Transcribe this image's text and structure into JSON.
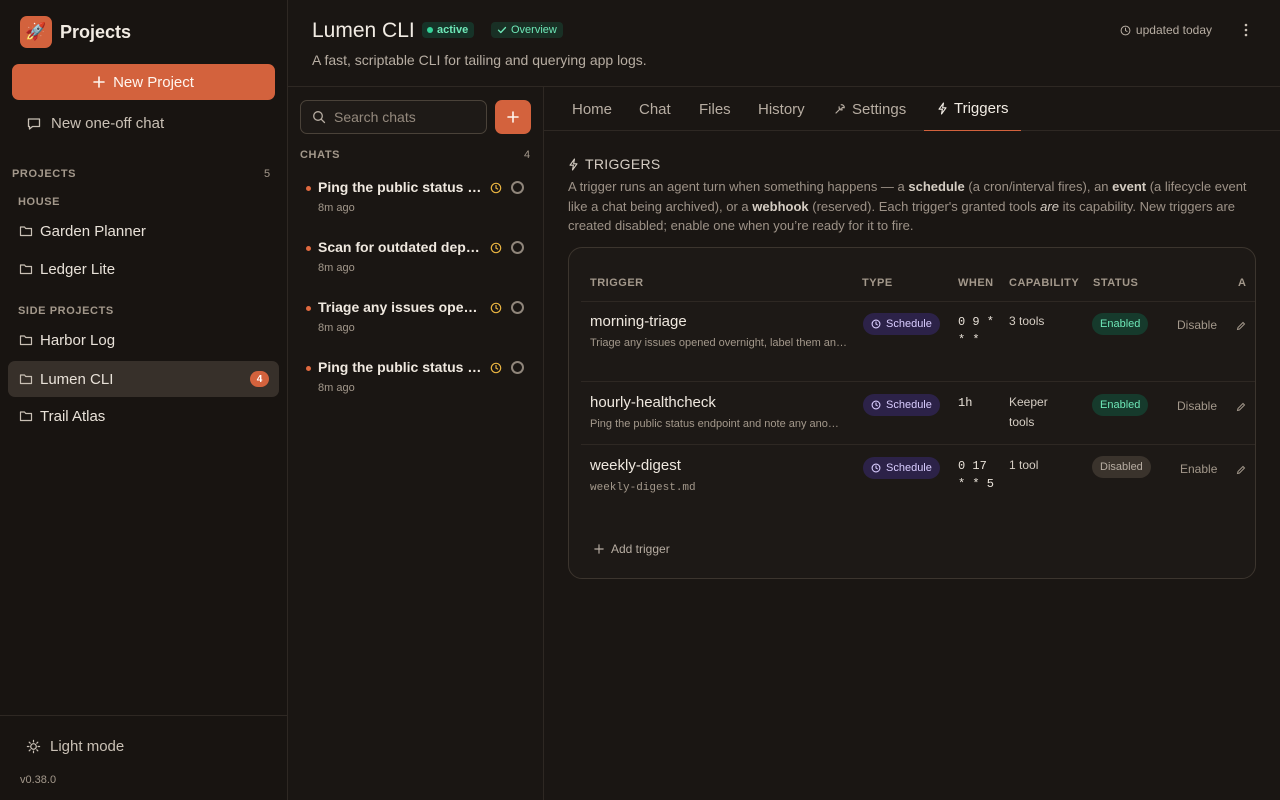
{
  "app": {
    "brand": "Projects",
    "logo_emoji": "🚀",
    "version": "v0.38.0",
    "light_mode_label": "Light mode"
  },
  "sidebar": {
    "new_project_label": "New Project",
    "oneoff_label": "New one-off chat",
    "projects_heading": "PROJECTS",
    "projects_count": "5",
    "groups": [
      {
        "label": "HOUSE",
        "items": [
          {
            "label": "Garden Planner"
          },
          {
            "label": "Ledger Lite"
          }
        ]
      },
      {
        "label": "SIDE PROJECTS",
        "items": [
          {
            "label": "Harbor Log"
          },
          {
            "label": "Lumen CLI",
            "badge": "4",
            "active": true
          },
          {
            "label": "Trail Atlas"
          }
        ]
      }
    ]
  },
  "header": {
    "title": "Lumen CLI",
    "status_badge": "active",
    "overview_badge": "Overview",
    "description": "A fast, scriptable CLI for tailing and querying app logs.",
    "updated": "updated today"
  },
  "chats": {
    "search_placeholder": "Search chats",
    "heading": "CHATS",
    "count": "4",
    "items": [
      {
        "title": "Ping the public status endpoint",
        "time": "8m ago"
      },
      {
        "title": "Scan for outdated dependencies",
        "time": "8m ago"
      },
      {
        "title": "Triage any issues opened overnight",
        "time": "8m ago"
      },
      {
        "title": "Ping the public status endpoint",
        "time": "8m ago"
      }
    ]
  },
  "tabs": [
    {
      "label": "Home"
    },
    {
      "label": "Chat"
    },
    {
      "label": "Files"
    },
    {
      "label": "History"
    },
    {
      "label": "Settings",
      "icon": "wrench-icon"
    },
    {
      "label": "Triggers",
      "icon": "bolt-icon",
      "active": true
    }
  ],
  "triggers": {
    "heading": "TRIGGERS",
    "desc": {
      "p1": "A trigger runs an agent turn when something happens — a ",
      "schedule": "schedule",
      "p2": " (a cron/interval fires), an ",
      "event": "event",
      "p3": " (a lifecycle event like a chat being archived), or a ",
      "webhook": "webhook",
      "p4": " (reserved). Each trigger's granted tools ",
      "are": "are",
      "p5": " its capability. New triggers are created disabled; enable one when you’re ready for it to fire."
    },
    "columns": [
      "TRIGGER",
      "TYPE",
      "WHEN",
      "CAPABILITY",
      "STATUS",
      "A"
    ],
    "rows": [
      {
        "name": "morning-triage",
        "desc": "Triage any issues opened overnight, label them and summarize",
        "type": "Schedule",
        "when": "0 9 * * *",
        "capability": "3 tools",
        "status": "Enabled",
        "action": "Disable",
        "enabled": true
      },
      {
        "name": "hourly-healthcheck",
        "desc": "Ping the public status endpoint and note any anomalies",
        "type": "Schedule",
        "when": "1h",
        "capability": "Keeper tools",
        "status": "Enabled",
        "action": "Disable",
        "enabled": true
      },
      {
        "name": "weekly-digest",
        "desc": "weekly-digest.md",
        "type": "Schedule",
        "when": "0 17 * * 5",
        "capability": "1 tool",
        "status": "Disabled",
        "action": "Enable",
        "enabled": false
      }
    ],
    "add_label": "Add trigger"
  },
  "colors": {
    "accent": "#d3623d",
    "background": "#1a1613",
    "enabled": "#6ee7b7",
    "schedule": "#2c2248"
  }
}
